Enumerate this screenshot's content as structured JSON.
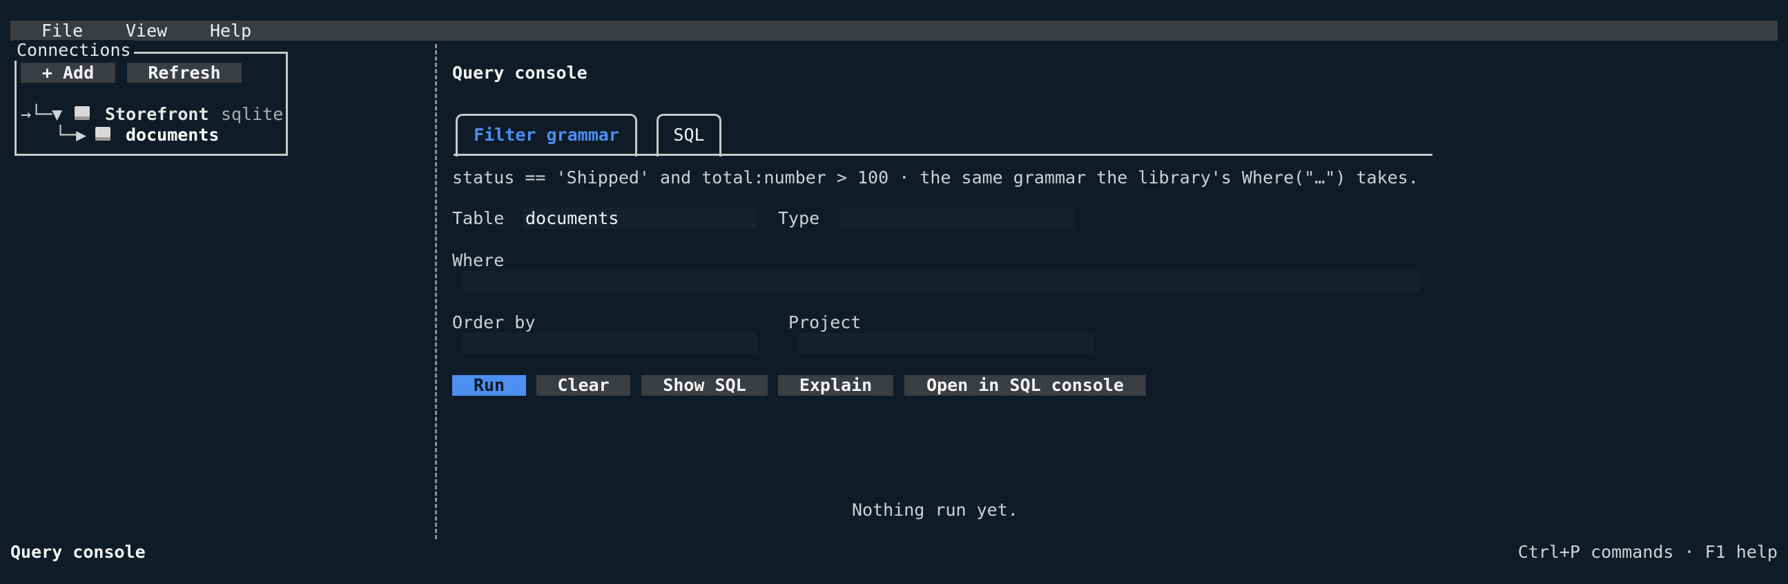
{
  "menu": {
    "items": [
      "File",
      "View",
      "Help"
    ]
  },
  "connections": {
    "title": "Connections",
    "add_label": "+ Add",
    "refresh_label": "Refresh",
    "tree": {
      "root_prefix": "→└─▼",
      "root_name": "Storefront",
      "root_driver": "sqlite",
      "child_prefix": "└─▶",
      "child_name": "documents"
    }
  },
  "main": {
    "title": "Query console",
    "tabs": [
      {
        "label": "Filter grammar",
        "active": true
      },
      {
        "label": "SQL",
        "active": false
      }
    ],
    "hint": "status == 'Shipped' and total:number > 100 · the same grammar the library's Where(\"…\") takes.",
    "form": {
      "table_label": "Table",
      "table_value": "documents",
      "type_label": "Type",
      "type_value": "",
      "where_label": "Where",
      "where_value": "",
      "order_label": "Order by",
      "order_value": "",
      "project_label": "Project",
      "project_value": ""
    },
    "actions": {
      "run": "Run",
      "clear": "Clear",
      "show_sql": "Show SQL",
      "explain": "Explain",
      "open_sql": "Open in SQL console"
    },
    "result_message": "Nothing run yet."
  },
  "status_bar": {
    "left": "Query console",
    "right": "Ctrl+P commands · F1 help"
  },
  "colors": {
    "background": "#0f1c27",
    "accent": "#4b8ff0",
    "button_bg": "#3a3d41",
    "muted_text": "#a8adb3"
  }
}
